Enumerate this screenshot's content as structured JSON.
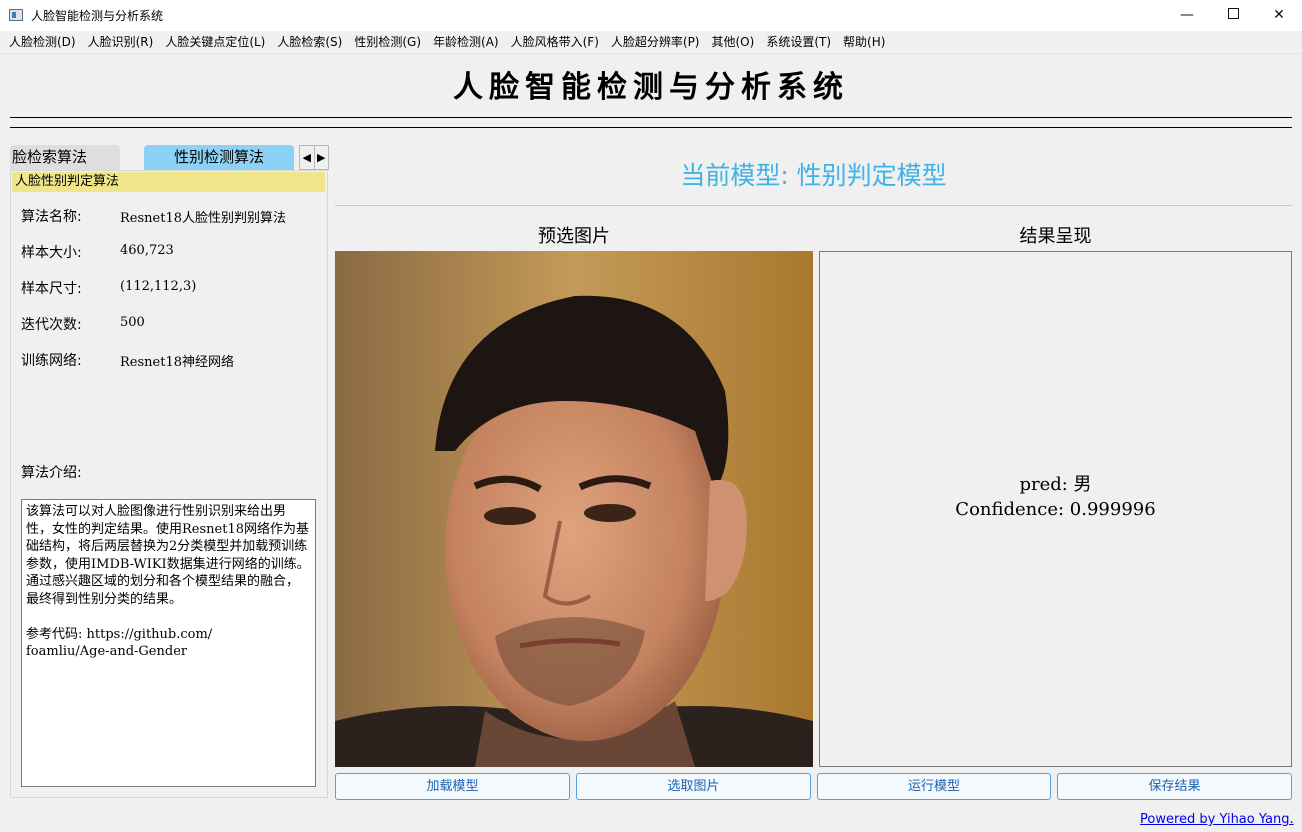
{
  "window": {
    "title": "人脸智能检测与分析系统",
    "minimize": "—",
    "close": "✕"
  },
  "menu": [
    "人脸检测(D)",
    "人脸识别(R)",
    "人脸关键点定位(L)",
    "人脸检索(S)",
    "性别检测(G)",
    "年龄检测(A)",
    "人脸风格带入(F)",
    "人脸超分辨率(P)",
    "其他(O)",
    "系统设置(T)",
    "帮助(H)"
  ],
  "header": {
    "title": "人脸智能检测与分析系统"
  },
  "tabs": {
    "face_search": "脸检索算法",
    "gender": "性别检测算法",
    "left_arrow": "◀",
    "right_arrow": "▶"
  },
  "algorithm": {
    "heading": "人脸性别判定算法",
    "name_label": "算法名称:",
    "name_value": "Resnet18人脸性别判别算法",
    "size_label": "样本大小:",
    "size_value": "460,723",
    "dims_label": "样本尺寸:",
    "dims_value": "(112,112,3)",
    "iter_label": "迭代次数:",
    "iter_value": "500",
    "net_label": "训练网络:",
    "net_value": "Resnet18神经网络",
    "intro_label": "算法介绍:",
    "intro_text": "该算法可以对人脸图像进行性别识别来给出男性，女性的判定结果。使用Resnet18网络作为基础结构，将后两层替换为2分类模型并加载预训练参数，使用IMDB-WIKI数据集进行网络的训练。通过感兴趣区域的划分和各个模型结果的融合，最终得到性别分类的结果。\n\n参考代码: https://github.com/\nfoamliu/Age-and-Gender"
  },
  "main": {
    "model_title": "当前模型: 性别判定模型",
    "preview_title": "预选图片",
    "result_title": "结果呈现",
    "result_pred": "pred:  男",
    "result_confidence": "Confidence:  0.999996"
  },
  "buttons": {
    "load_model": "加载模型",
    "select_image": "选取图片",
    "run_model": "运行模型",
    "save_result": "保存结果"
  },
  "footer": {
    "powered": "Powered by Yihao Yang."
  },
  "colors": {
    "accent_blue": "#3eb3e6",
    "tab_selected": "#8cd2f5",
    "algo_header": "#efe68c",
    "button_border": "#5aa0d6",
    "link": "#0000ee"
  }
}
